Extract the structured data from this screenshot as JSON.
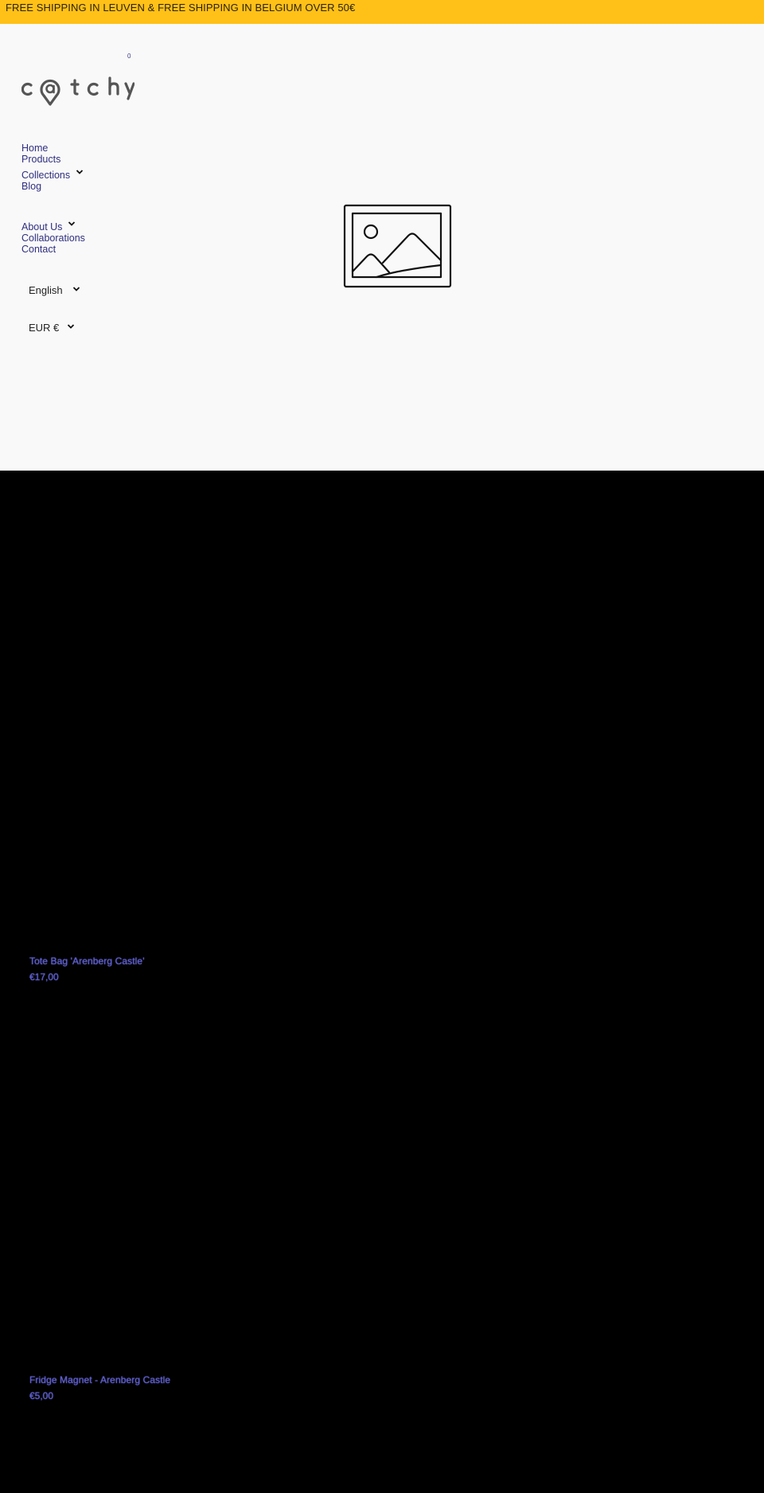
{
  "announcement": {
    "text": "FREE SHIPPING IN LEUVEN & FREE SHIPPING IN BELGIUM OVER 50€"
  },
  "header": {
    "logo_text": "catchy",
    "cart_count": "0",
    "nav": [
      {
        "label": "Home",
        "has_dropdown": false
      },
      {
        "label": "Products",
        "has_dropdown": false
      },
      {
        "label": "Collections",
        "has_dropdown": true
      },
      {
        "label": "Blog",
        "has_dropdown": false
      },
      {
        "label": "About Us",
        "has_dropdown": true
      },
      {
        "label": "Collaborations",
        "has_dropdown": false
      },
      {
        "label": "Contact",
        "has_dropdown": false
      }
    ],
    "language": {
      "selected": "English"
    },
    "currency": {
      "selected": "EUR €"
    }
  },
  "hero": {
    "image_icon": "image-placeholder-icon"
  },
  "products": [
    {
      "title": "Tote Bag 'Arenberg Castle'",
      "price": "€17,00"
    },
    {
      "title": "Fridge Magnet - Arenberg Castle",
      "price": "€5,00"
    }
  ],
  "colors": {
    "announcement_bg": "#ffc117",
    "header_bg": "#f9f9f9",
    "nav_link": "#2f2f80",
    "product_text": "#5a5ad0",
    "page_bg": "#000000"
  }
}
